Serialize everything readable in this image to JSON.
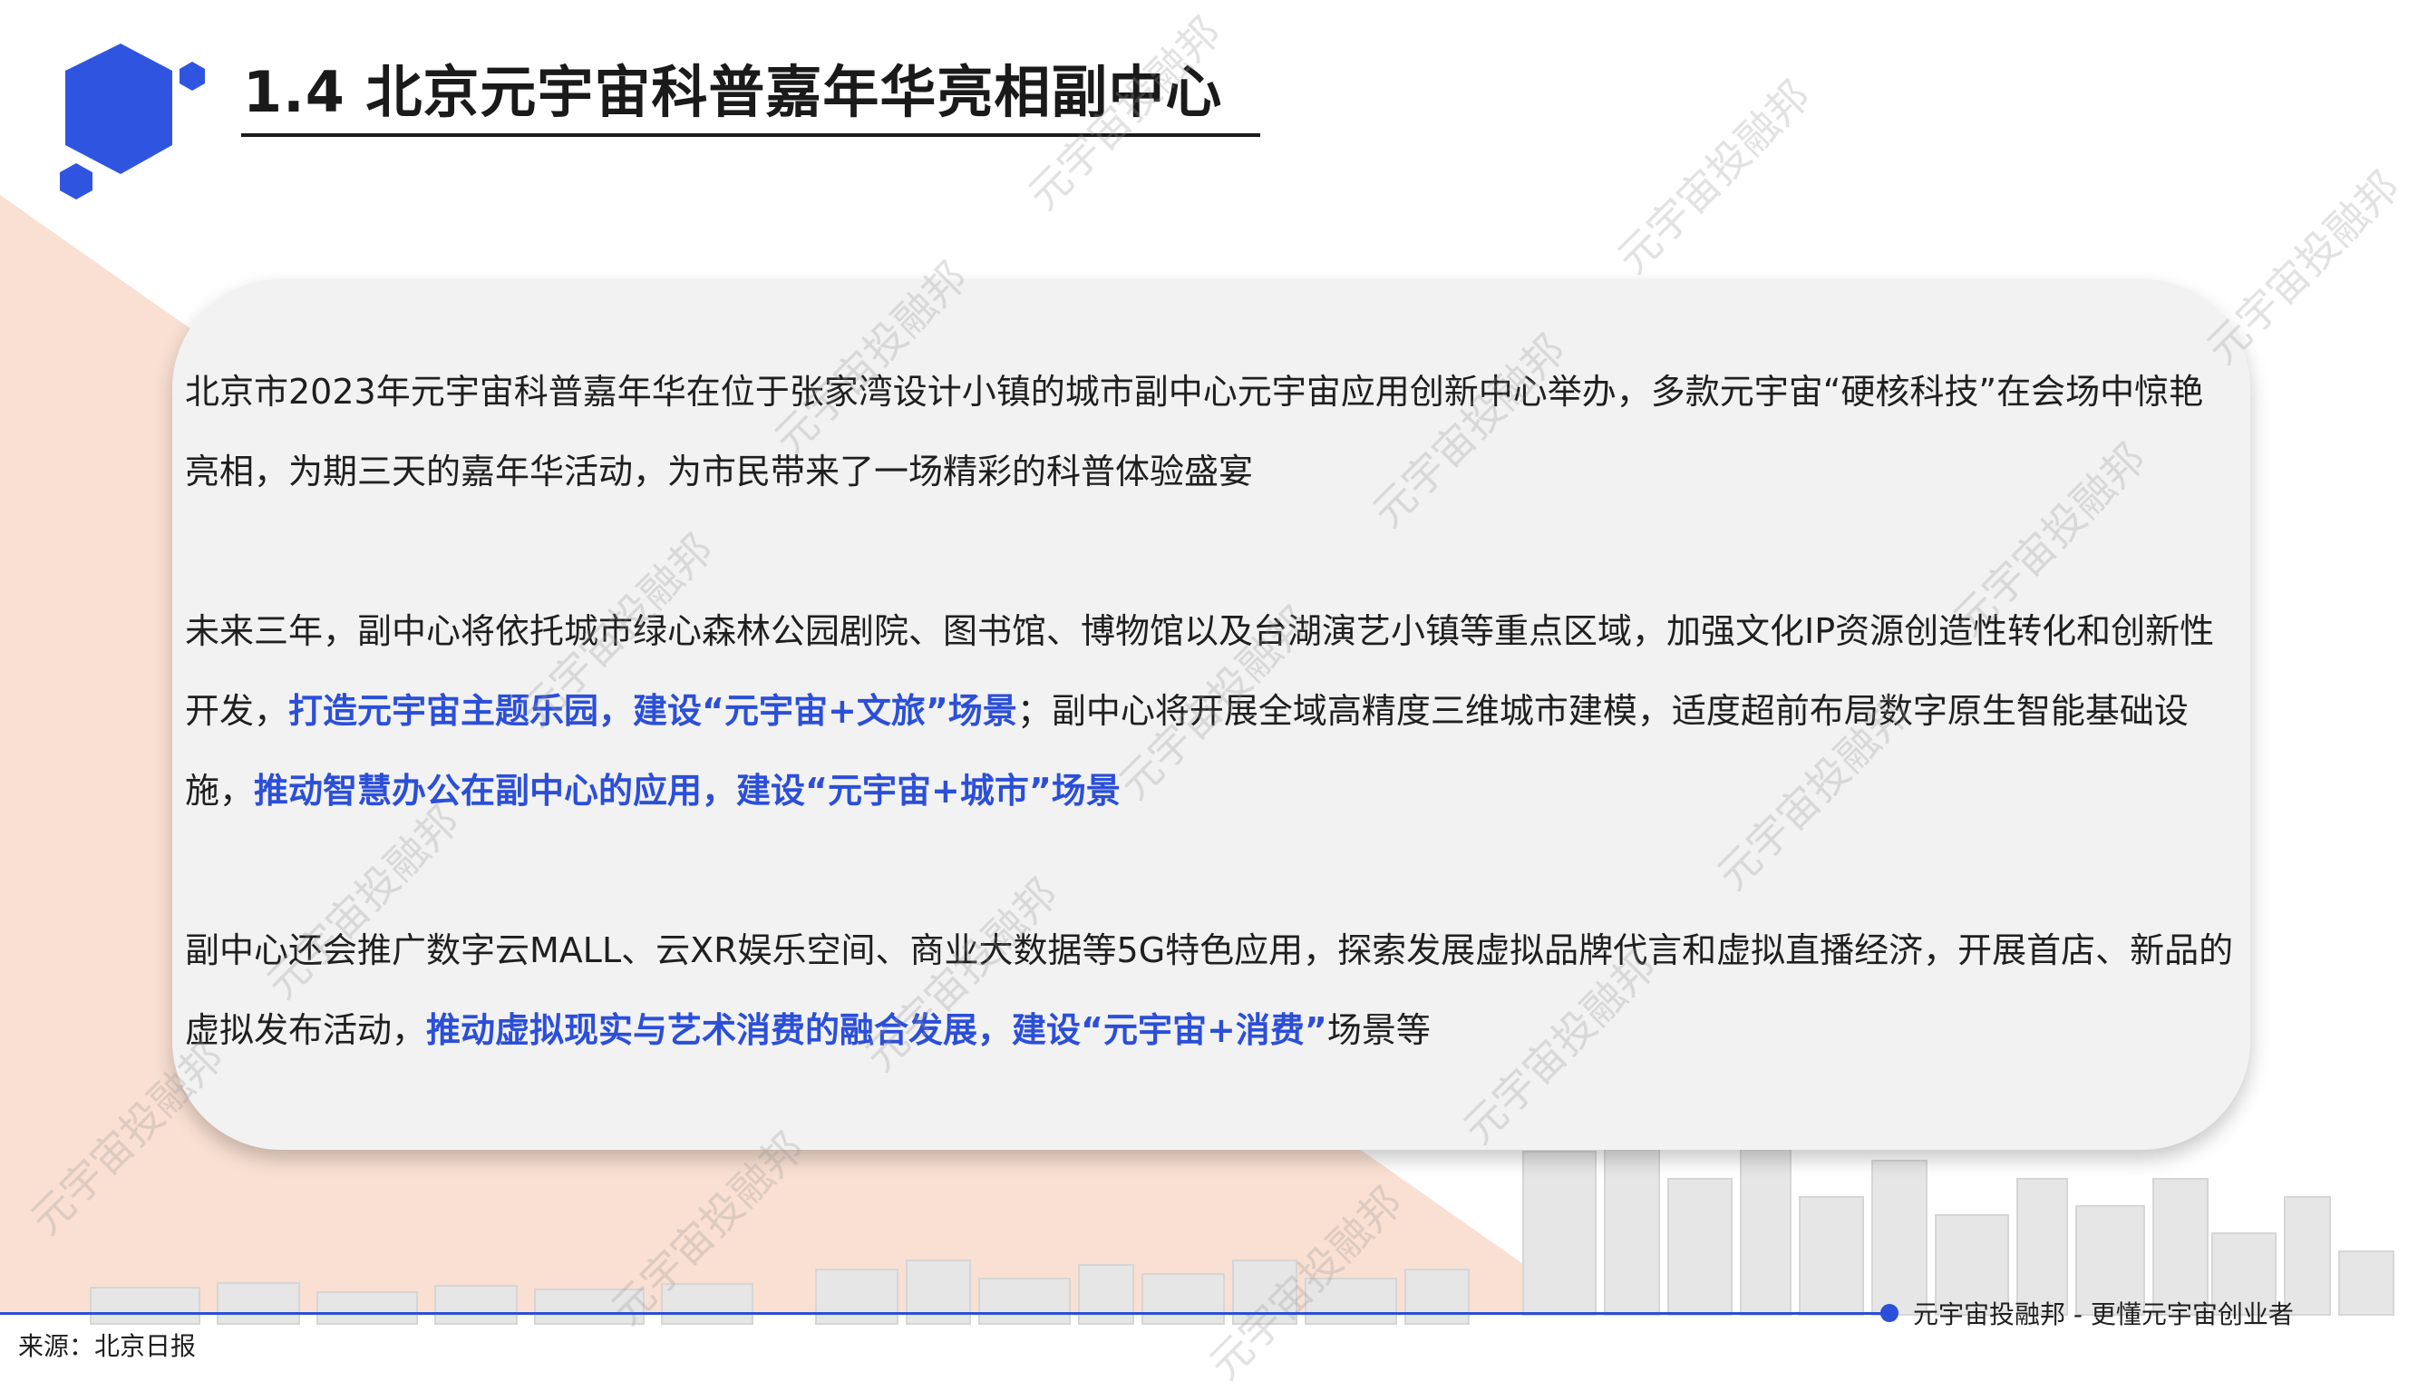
{
  "header": {
    "title": "1.4 北京元宇宙科普嘉年华亮相副中心"
  },
  "content": {
    "paragraphs": [
      [
        {
          "text": "北京市2023年元宇宙科普嘉年华在位于张家湾设计小镇的城市副中心元宇宙应用创新中心举办，多款元宇宙“硬核科技”在会场中惊艳亮相，为期三天的嘉年华活动，为市民带来了一场精彩的科普体验盛宴",
          "highlight": false
        }
      ],
      [
        {
          "text": "未来三年，副中心将依托城市绿心森林公园剧院、图书馆、博物馆以及台湖演艺小镇等重点区域，加强文化IP资源创造性转化和创新性开发，",
          "highlight": false
        },
        {
          "text": "打造元宇宙主题乐园，建设“元宇宙+文旅”场景",
          "highlight": true
        },
        {
          "text": "；副中心将开展全域高精度三维城市建模，适度超前布局数字原生智能基础设施，",
          "highlight": false
        },
        {
          "text": "推动智慧办公在副中心的应用，建设“元宇宙+城市”场景",
          "highlight": true
        }
      ],
      [
        {
          "text": "副中心还会推广数字云MALL、云XR娱乐空间、商业大数据等5G特色应用，探索发展虚拟品牌代言和虚拟直播经济，开展首店、新品的虚拟发布活动，",
          "highlight": false
        },
        {
          "text": "推动虚拟现实与艺术消费的融合发展，建设“元宇宙+消费”",
          "highlight": true
        },
        {
          "text": "场景等",
          "highlight": false
        }
      ]
    ]
  },
  "footer": {
    "source": "来源：北京日报",
    "brand": "元宇宙投融邦 - 更懂元宇宙创业者"
  },
  "watermark": {
    "text": "元宇宙投融邦"
  },
  "colors": {
    "accent": "#2b4fd8",
    "background_shape": "#f9e0d2",
    "card": "#f2f2f2",
    "text": "#1f1f1f"
  }
}
